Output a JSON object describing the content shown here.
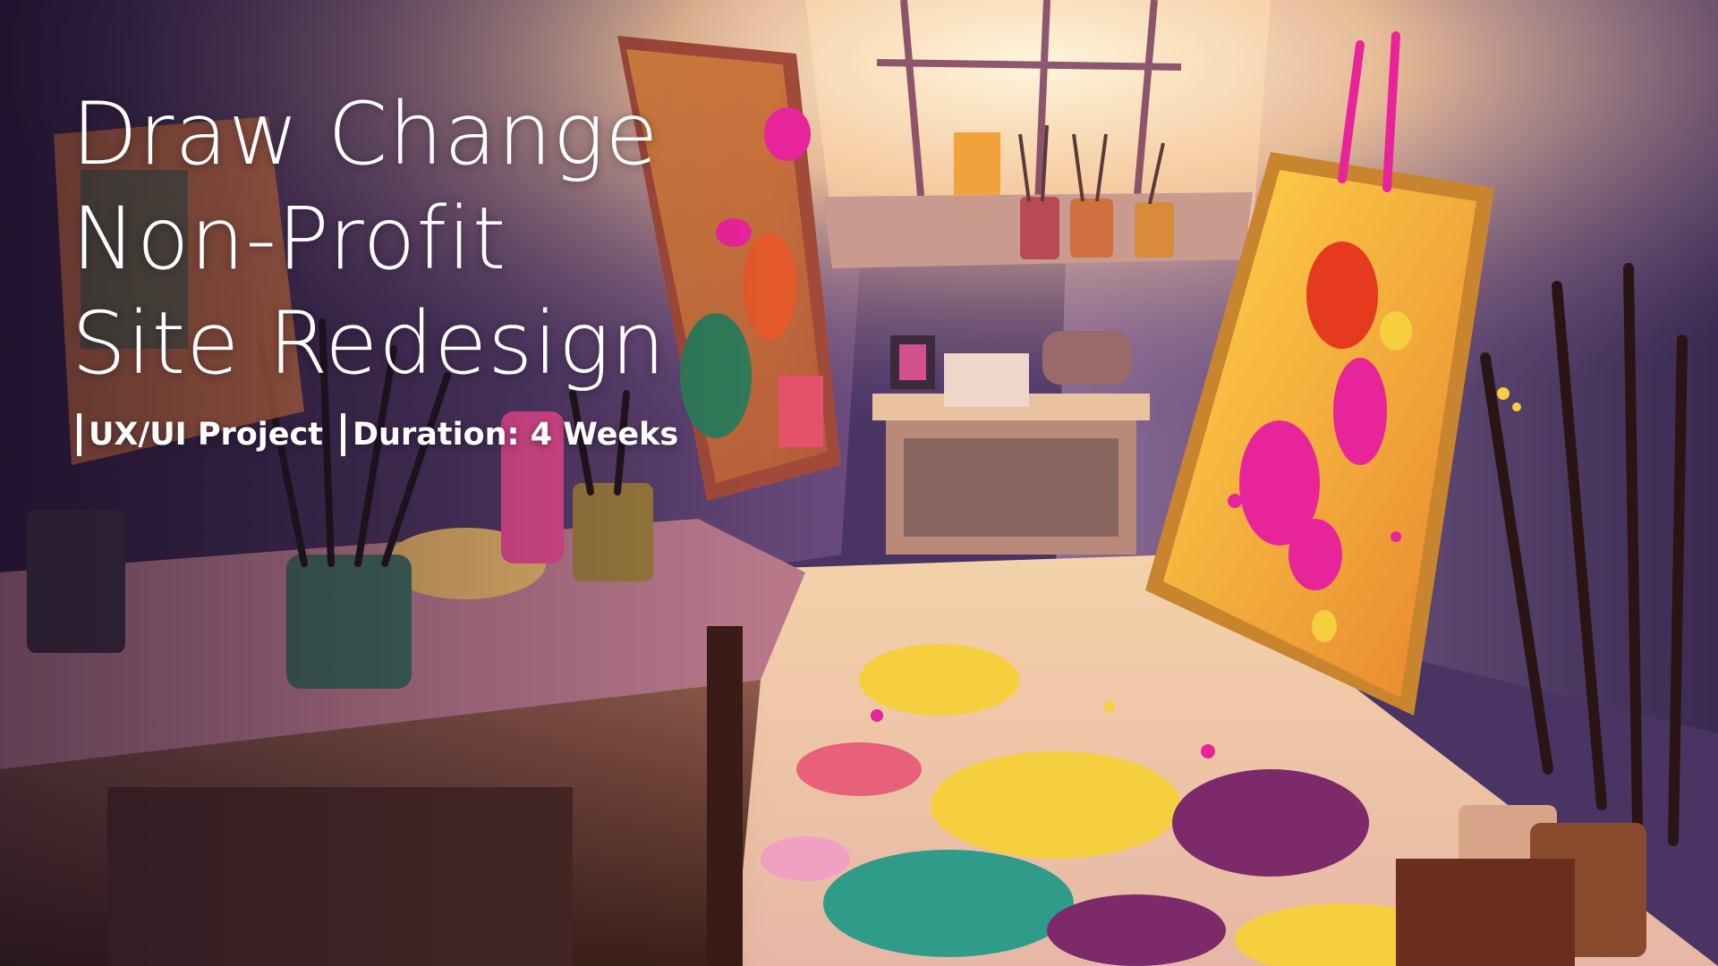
{
  "hero": {
    "title_lines": [
      "Draw Change",
      "Non-Profit",
      "Site Redesign"
    ],
    "tags": [
      "UX/UI Project",
      "Duration: 4 Weeks"
    ]
  },
  "colors": {
    "text": "#ffffff",
    "window_light": "#fff3d6",
    "wall_purple": "#6a4a86",
    "canvas_orange": "#f2a23c",
    "paint_magenta": "#e8249a",
    "paint_yellow": "#f6cf3e",
    "paint_teal": "#2f9c8a",
    "paint_plum": "#7c2a6a",
    "wood_brown": "#5a2e1e"
  }
}
